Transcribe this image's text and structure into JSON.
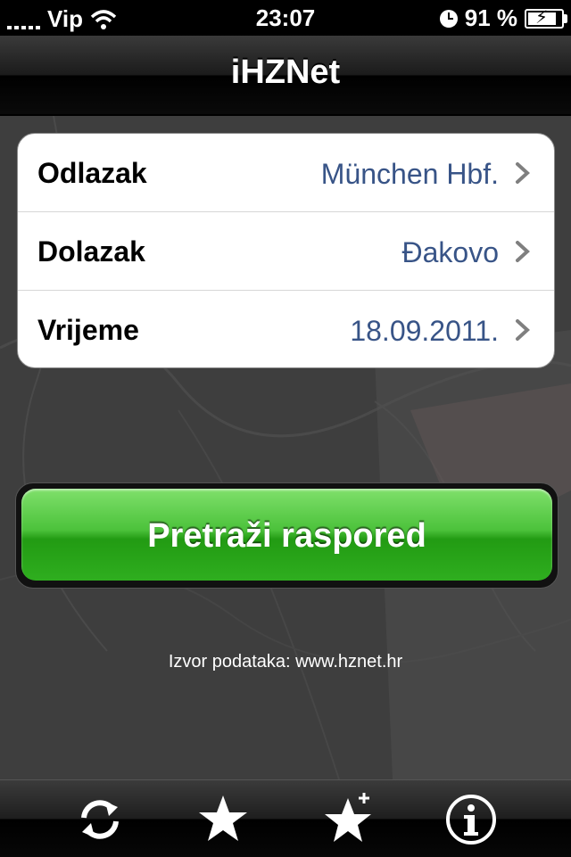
{
  "status_bar": {
    "carrier": "Vip",
    "time": "23:07",
    "battery": "91 %",
    "battery_level": 0.91
  },
  "nav": {
    "title": "iHZNet"
  },
  "form": {
    "rows": [
      {
        "label": "Odlazak",
        "value": "München Hbf."
      },
      {
        "label": "Dolazak",
        "value": "Đakovo"
      },
      {
        "label": "Vrijeme",
        "value": "18.09.2011."
      }
    ]
  },
  "search_button": {
    "label": "Pretraži raspored"
  },
  "footer": {
    "source": "Izvor podataka: www.hznet.hr"
  },
  "tabs": [
    {
      "icon": "swap-icon"
    },
    {
      "icon": "star-icon"
    },
    {
      "icon": "star-add-icon"
    },
    {
      "icon": "info-icon"
    }
  ],
  "colors": {
    "value_text": "#385487",
    "button_green": "#2fae1f"
  }
}
